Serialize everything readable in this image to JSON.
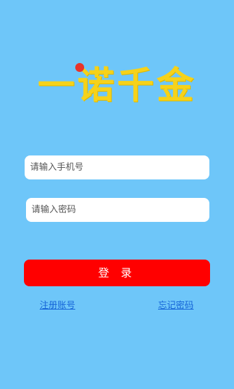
{
  "logo": {
    "text": "一诺千金",
    "primary_color": "#f6d21a",
    "dot_color": "#e8332a"
  },
  "form": {
    "phone_placeholder": "请输入手机号",
    "password_placeholder": "请输入密码",
    "login_label": "登 录"
  },
  "links": {
    "register": "注册账号",
    "forgot_password": "忘记密码"
  },
  "colors": {
    "background": "#6ec6f9",
    "button": "#ff0000",
    "link": "#1565d8"
  }
}
